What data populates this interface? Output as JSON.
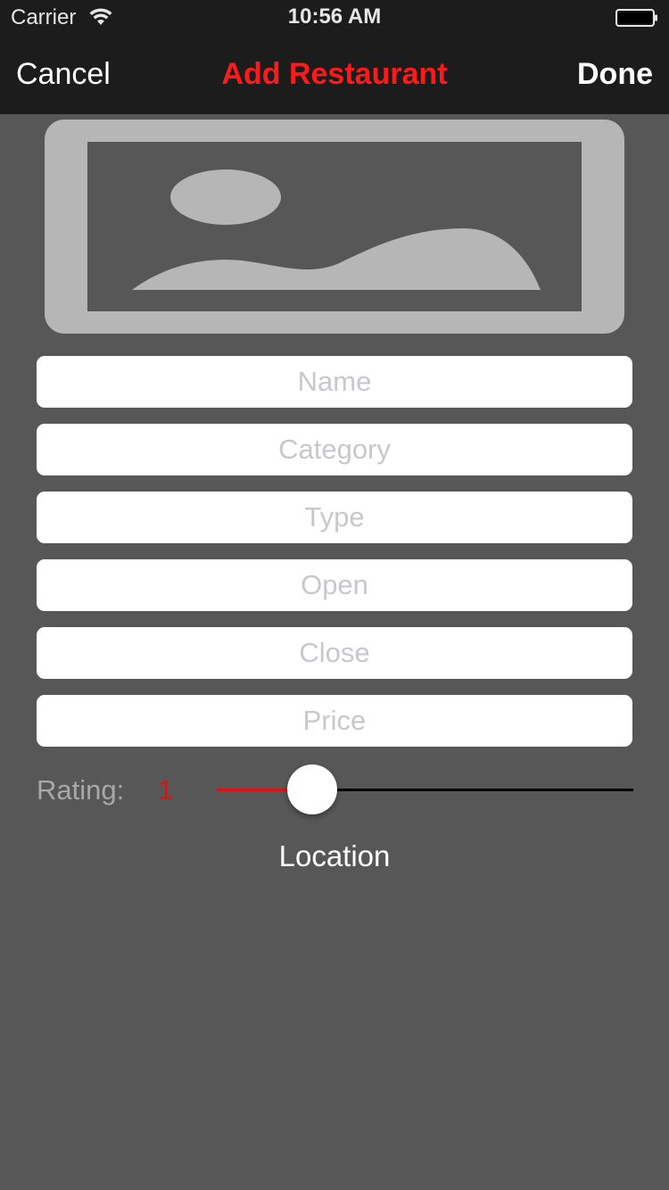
{
  "status_bar": {
    "carrier": "Carrier",
    "time": "10:56 AM",
    "wifi_icon": "wifi-icon",
    "battery_icon": "battery-icon"
  },
  "nav": {
    "cancel_label": "Cancel",
    "title": "Add Restaurant",
    "done_label": "Done",
    "title_color": "#ff1a1a"
  },
  "photo": {
    "icon": "image-placeholder-icon"
  },
  "form": {
    "name_placeholder": "Name",
    "category_placeholder": "Category",
    "type_placeholder": "Type",
    "open_placeholder": "Open",
    "close_placeholder": "Close",
    "price_placeholder": "Price"
  },
  "rating": {
    "label": "Rating:",
    "value": "1",
    "slider_fraction": 0.23,
    "accent_color": "#e01010"
  },
  "location": {
    "label": "Location"
  },
  "colors": {
    "background": "#575757",
    "bar_background": "#1c1c1c"
  }
}
